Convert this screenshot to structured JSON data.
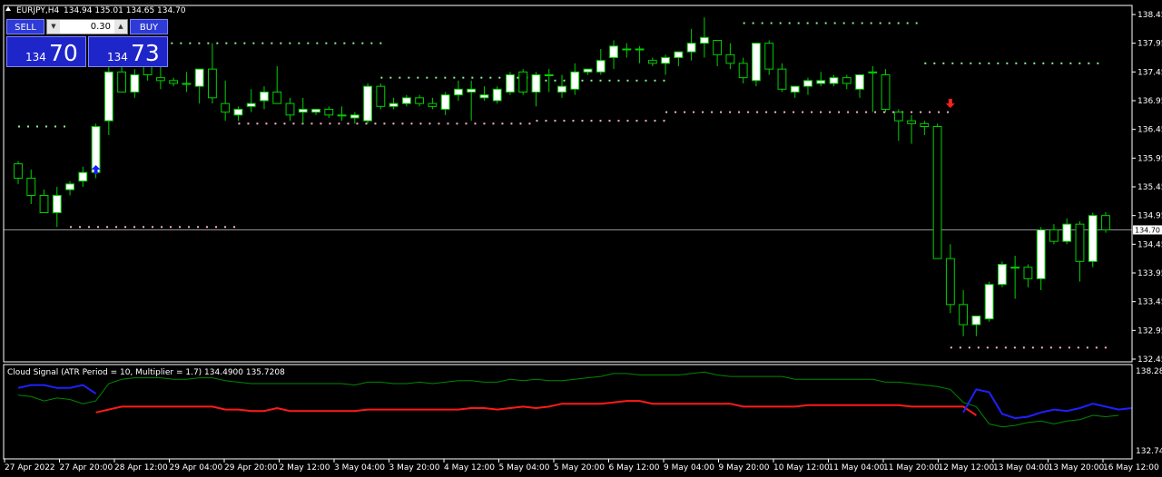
{
  "header": {
    "symbol": "EURJPY,H4",
    "ohlc": "134.94 135.01 134.65 134.70",
    "menu_icon": "triangle-up-icon"
  },
  "trade_panel": {
    "sell_label": "SELL",
    "buy_label": "BUY",
    "lot": "0.30",
    "sell_small": "134",
    "sell_big": "70",
    "buy_small": "134",
    "buy_big": "73"
  },
  "indicator": {
    "label": "Cloud Signal (ATR Period = 10, Multiplier = 1.7) 134.4900 135.7208"
  },
  "colors": {
    "bull_body": "#ffffff",
    "bear_body": "#000000",
    "wick": "#00d000",
    "grid": "#ffffff",
    "sup_dots": "#ffb6c1",
    "res_dots": "#90ee90",
    "indicator_red": "#ff1a1a",
    "indicator_blue": "#2020ff",
    "indicator_green": "#008800"
  },
  "chart_data": {
    "type": "candlestick",
    "symbol": "EURJPY",
    "timeframe": "H4",
    "ylim": [
      132.45,
      138.45
    ],
    "y_ticks": [
      "138.45",
      "137.95",
      "137.45",
      "136.95",
      "136.45",
      "135.95",
      "135.45",
      "134.95",
      "134.45",
      "133.95",
      "133.45",
      "132.95",
      "132.45"
    ],
    "current_price": "134.70",
    "x_ticks": [
      "27 Apr 2022",
      "27 Apr 20:00",
      "28 Apr 12:00",
      "29 Apr 04:00",
      "29 Apr 20:00",
      "2 May 12:00",
      "3 May 04:00",
      "3 May 20:00",
      "4 May 12:00",
      "5 May 04:00",
      "5 May 20:00",
      "6 May 12:00",
      "9 May 04:00",
      "9 May 20:00",
      "10 May 12:00",
      "11 May 04:00",
      "11 May 20:00",
      "12 May 12:00",
      "13 May 04:00",
      "13 May 20:00",
      "16 May 12:00"
    ],
    "candles": [
      [
        135.85,
        135.9,
        135.5,
        135.6
      ],
      [
        135.6,
        135.75,
        135.15,
        135.3
      ],
      [
        135.3,
        135.4,
        135.0,
        135.0
      ],
      [
        135.0,
        135.45,
        134.75,
        135.3
      ],
      [
        135.4,
        135.55,
        135.3,
        135.5
      ],
      [
        135.55,
        135.8,
        135.45,
        135.7
      ],
      [
        135.7,
        136.55,
        135.6,
        136.5
      ],
      [
        136.6,
        137.75,
        136.35,
        137.45
      ],
      [
        137.45,
        137.75,
        137.1,
        137.1
      ],
      [
        137.1,
        137.5,
        137.0,
        137.4
      ],
      [
        137.6,
        137.9,
        137.3,
        137.4
      ],
      [
        137.35,
        137.55,
        137.15,
        137.3
      ],
      [
        137.3,
        137.35,
        137.2,
        137.25
      ],
      [
        137.25,
        137.45,
        137.1,
        137.25
      ],
      [
        137.2,
        137.5,
        136.9,
        137.5
      ],
      [
        137.5,
        137.95,
        136.9,
        137.0
      ],
      [
        136.9,
        137.3,
        136.6,
        136.75
      ],
      [
        136.7,
        136.85,
        136.6,
        136.8
      ],
      [
        136.85,
        137.15,
        136.75,
        136.9
      ],
      [
        136.95,
        137.2,
        136.8,
        137.1
      ],
      [
        137.1,
        137.55,
        136.9,
        136.9
      ],
      [
        136.9,
        137.0,
        136.6,
        136.7
      ],
      [
        136.75,
        137.0,
        136.55,
        136.8
      ],
      [
        136.75,
        136.8,
        136.7,
        136.8
      ],
      [
        136.8,
        136.85,
        136.65,
        136.7
      ],
      [
        136.7,
        136.85,
        136.6,
        136.7
      ],
      [
        136.65,
        136.75,
        136.55,
        136.7
      ],
      [
        136.6,
        137.25,
        136.55,
        137.2
      ],
      [
        137.2,
        137.25,
        136.8,
        136.85
      ],
      [
        136.85,
        137.0,
        136.8,
        136.9
      ],
      [
        136.9,
        137.05,
        136.85,
        137.0
      ],
      [
        137.0,
        137.05,
        136.85,
        136.9
      ],
      [
        136.9,
        137.0,
        136.8,
        136.85
      ],
      [
        136.8,
        137.1,
        136.7,
        137.05
      ],
      [
        137.05,
        137.3,
        136.95,
        137.15
      ],
      [
        137.1,
        137.3,
        136.6,
        137.15
      ],
      [
        137.0,
        137.2,
        136.95,
        137.05
      ],
      [
        136.95,
        137.2,
        136.9,
        137.15
      ],
      [
        137.1,
        137.45,
        137.05,
        137.4
      ],
      [
        137.45,
        137.5,
        137.05,
        137.1
      ],
      [
        137.1,
        137.45,
        136.85,
        137.4
      ],
      [
        137.4,
        137.5,
        137.1,
        137.4
      ],
      [
        137.1,
        137.4,
        137.0,
        137.2
      ],
      [
        137.15,
        137.6,
        137.05,
        137.45
      ],
      [
        137.45,
        137.5,
        137.4,
        137.5
      ],
      [
        137.45,
        137.85,
        137.4,
        137.65
      ],
      [
        137.7,
        138.0,
        137.5,
        137.9
      ],
      [
        137.85,
        137.95,
        137.7,
        137.85
      ],
      [
        137.85,
        137.9,
        137.6,
        137.85
      ],
      [
        137.65,
        137.7,
        137.55,
        137.6
      ],
      [
        137.6,
        137.75,
        137.4,
        137.7
      ],
      [
        137.7,
        137.8,
        137.55,
        137.8
      ],
      [
        137.8,
        138.2,
        137.65,
        137.95
      ],
      [
        137.95,
        138.4,
        137.7,
        138.05
      ],
      [
        138.0,
        138.0,
        137.55,
        137.75
      ],
      [
        137.75,
        137.95,
        137.5,
        137.6
      ],
      [
        137.6,
        137.7,
        137.25,
        137.35
      ],
      [
        137.3,
        137.9,
        137.2,
        137.95
      ],
      [
        137.95,
        138.0,
        137.4,
        137.5
      ],
      [
        137.5,
        137.6,
        137.1,
        137.15
      ],
      [
        137.1,
        137.2,
        137.0,
        137.2
      ],
      [
        137.2,
        137.35,
        137.05,
        137.3
      ],
      [
        137.25,
        137.45,
        137.2,
        137.3
      ],
      [
        137.25,
        137.4,
        137.2,
        137.35
      ],
      [
        137.35,
        137.4,
        137.15,
        137.25
      ],
      [
        137.15,
        137.4,
        137.0,
        137.4
      ],
      [
        137.45,
        137.55,
        136.75,
        137.45
      ],
      [
        137.4,
        137.5,
        136.75,
        136.8
      ],
      [
        136.75,
        136.8,
        136.25,
        136.6
      ],
      [
        136.6,
        136.7,
        136.2,
        136.55
      ],
      [
        136.55,
        136.6,
        136.35,
        136.5
      ],
      [
        136.5,
        136.55,
        134.2,
        134.2
      ],
      [
        134.2,
        134.45,
        133.25,
        133.4
      ],
      [
        133.4,
        133.65,
        132.85,
        133.05
      ],
      [
        133.05,
        133.2,
        132.85,
        133.2
      ],
      [
        133.15,
        133.8,
        133.1,
        133.75
      ],
      [
        133.75,
        134.15,
        133.7,
        134.1
      ],
      [
        134.05,
        134.25,
        133.5,
        134.05
      ],
      [
        134.05,
        134.1,
        133.7,
        133.85
      ],
      [
        133.85,
        134.75,
        133.65,
        134.7
      ],
      [
        134.7,
        134.8,
        134.45,
        134.5
      ],
      [
        134.5,
        134.9,
        134.45,
        134.8
      ],
      [
        134.8,
        134.85,
        133.8,
        134.15
      ],
      [
        134.15,
        135.0,
        134.05,
        134.95
      ],
      [
        134.95,
        135.01,
        134.65,
        134.7
      ]
    ],
    "support_dots": [
      {
        "from": 4,
        "to": 17,
        "price": 134.75
      },
      {
        "from": 17,
        "to": 40,
        "price": 136.55
      },
      {
        "from": 40,
        "to": 50,
        "price": 136.6
      },
      {
        "from": 50,
        "to": 72,
        "price": 136.75
      },
      {
        "from": 72,
        "to": 84,
        "price": 132.65
      }
    ],
    "resistance_dots": [
      {
        "from": 0,
        "to": 4,
        "price": 136.5
      },
      {
        "from": 9,
        "to": 28,
        "price": 137.95
      },
      {
        "from": 28,
        "to": 40,
        "price": 137.35
      },
      {
        "from": 40,
        "to": 50,
        "price": 137.3
      },
      {
        "from": 56,
        "to": 70,
        "price": 138.3
      },
      {
        "from": 70,
        "to": 84,
        "price": 137.6
      }
    ],
    "arrows": [
      {
        "type": "buy",
        "index": 6,
        "price": 135.75
      },
      {
        "type": "sell",
        "index": 72,
        "price": 136.9
      }
    ],
    "indicator": {
      "ylim": [
        132.743,
        138.281
      ],
      "y_ticks": [
        "138.281",
        "132.743"
      ],
      "upper": [
        136.6,
        136.5,
        136.2,
        136.4,
        136.3,
        136.0,
        136.2,
        137.4,
        137.7,
        137.8,
        137.8,
        137.8,
        137.7,
        137.7,
        137.8,
        137.8,
        137.6,
        137.5,
        137.4,
        137.4,
        137.4,
        137.4,
        137.4,
        137.4,
        137.4,
        137.4,
        137.3,
        137.5,
        137.5,
        137.4,
        137.4,
        137.5,
        137.4,
        137.5,
        137.6,
        137.6,
        137.5,
        137.5,
        137.7,
        137.6,
        137.7,
        137.6,
        137.6,
        137.7,
        137.8,
        137.9,
        138.1,
        138.1,
        138.0,
        138.0,
        138.0,
        138.0,
        138.1,
        138.2,
        138.0,
        137.9,
        137.9,
        137.9,
        137.9,
        137.9,
        137.7,
        137.7,
        137.7,
        137.7,
        137.7,
        137.7,
        137.7,
        137.5,
        137.5,
        137.4,
        137.3,
        137.2,
        137.0,
        136.1,
        135.8,
        134.6,
        134.4,
        134.5,
        134.7,
        134.8,
        134.6,
        134.8,
        134.9,
        135.2,
        135.1,
        135.2
      ],
      "lower_red": [
        null,
        null,
        null,
        null,
        null,
        null,
        135.4,
        135.6,
        135.8,
        135.8,
        135.8,
        135.8,
        135.8,
        135.8,
        135.8,
        135.8,
        135.6,
        135.6,
        135.5,
        135.5,
        135.7,
        135.5,
        135.5,
        135.5,
        135.5,
        135.5,
        135.5,
        135.6,
        135.6,
        135.6,
        135.6,
        135.6,
        135.6,
        135.6,
        135.6,
        135.7,
        135.7,
        135.6,
        135.7,
        135.8,
        135.7,
        135.8,
        136.0,
        136.0,
        136.0,
        136.0,
        136.1,
        136.2,
        136.2,
        136.0,
        136.0,
        136.0,
        136.0,
        136.0,
        136.0,
        136.0,
        135.8,
        135.8,
        135.8,
        135.8,
        135.8,
        135.9,
        135.9,
        135.9,
        135.9,
        135.9,
        135.9,
        135.9,
        135.9,
        135.8,
        135.8,
        135.8,
        135.8,
        135.8,
        135.2,
        null,
        null,
        null,
        null,
        null,
        null,
        null,
        null,
        null,
        null,
        null
      ],
      "upper_blue": [
        137.1,
        137.3,
        137.3,
        137.1,
        137.1,
        137.3,
        136.7,
        null,
        null,
        null,
        null,
        null,
        null,
        null,
        null,
        null,
        null,
        null,
        null,
        null,
        null,
        null,
        null,
        null,
        null,
        null,
        null,
        null,
        null,
        null,
        null,
        null,
        null,
        null,
        null,
        null,
        null,
        null,
        null,
        null,
        null,
        null,
        null,
        null,
        null,
        null,
        null,
        null,
        null,
        null,
        null,
        null,
        null,
        null,
        null,
        null,
        null,
        null,
        null,
        null,
        null,
        null,
        null,
        null,
        null,
        null,
        null,
        null,
        null,
        null,
        null,
        null,
        null,
        135.4,
        137.0,
        136.8,
        135.3,
        135.0,
        135.1,
        135.4,
        135.6,
        135.5,
        135.7,
        136.0,
        135.8,
        135.6,
        135.7
      ]
    }
  }
}
